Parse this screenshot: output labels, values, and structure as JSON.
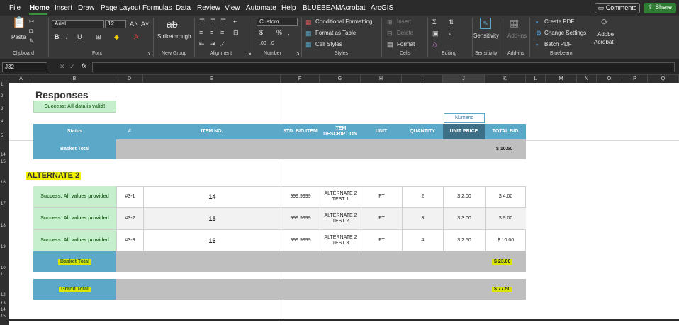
{
  "menu": {
    "items": [
      "File",
      "Home",
      "Insert",
      "Draw",
      "Page Layout",
      "Formulas",
      "Data",
      "Review",
      "View",
      "Automate",
      "Help",
      "BLUEBEAM",
      "Acrobat",
      "ArcGIS"
    ],
    "comments": "Comments",
    "share": "Share"
  },
  "ribbon": {
    "paste": "Paste",
    "font_name": "Arial",
    "font_size": "12",
    "strikethrough": "Strikethrough",
    "number_format": "Custom",
    "conditional_formatting": "Conditional Formatting",
    "format_as_table": "Format as Table",
    "cell_styles": "Cell Styles",
    "insert": "Insert",
    "delete": "Delete",
    "format": "Format",
    "sensitivity": "Sensitivity",
    "addins": "Add-ins",
    "create_pdf": "Create PDF",
    "change_settings": "Change Settings",
    "batch_pdf": "Batch PDF",
    "adobe": "Adobe",
    "acrobat": "Acrobat",
    "groups": [
      "Clipboard",
      "Font",
      "New Group",
      "Alignment",
      "Number",
      "Styles",
      "Cells",
      "Editing",
      "Sensitivity",
      "Add-ins",
      "Bluebeam"
    ]
  },
  "formula_bar": {
    "name_box": "J32",
    "fx": "fx",
    "formula": ""
  },
  "columns": [
    "A",
    "B",
    "D",
    "E",
    "F",
    "G",
    "H",
    "I",
    "J",
    "K",
    "L",
    "M",
    "N",
    "O",
    "P",
    "Q"
  ],
  "rows": [
    "1",
    "2",
    "3",
    "4",
    "5",
    "14",
    "15",
    "16",
    "17",
    "18",
    "19",
    "10",
    "11",
    "12",
    "13",
    "14",
    "15"
  ],
  "sheet": {
    "title": "Responses",
    "validation": "Success: All data is valid!",
    "numeric_label": "Numeric",
    "headers": [
      "Status",
      "#",
      "ITEM NO.",
      "STD. BID ITEM",
      "ITEM DESCRIPTION",
      "UNIT",
      "QUANTITY",
      "UNIT PRICE",
      "TOTAL BID"
    ],
    "basket_total_label": "Basket Total",
    "basket_total_value": "$ 10.50",
    "section_title": "ALTERNATE 2",
    "items": [
      {
        "status": "Success: All values provided",
        "num": "#3-1",
        "item_no": "14",
        "std": "999.9999",
        "desc": "ALTERNATE 2 TEST 1",
        "unit": "FT",
        "qty": "2",
        "price": "$ 2.00",
        "total": "$ 4.00"
      },
      {
        "status": "Success: All values provided",
        "num": "#3-2",
        "item_no": "15",
        "std": "999.9999",
        "desc": "ALTERNATE 2 TEST 2",
        "unit": "FT",
        "qty": "3",
        "price": "$ 3.00",
        "total": "$ 9.00"
      },
      {
        "status": "Success: All values provided",
        "num": "#3-3",
        "item_no": "16",
        "std": "999.9999",
        "desc": "ALTERNATE 2 TEST 3",
        "unit": "FT",
        "qty": "4",
        "price": "$ 2.50",
        "total": "$ 10.00"
      }
    ],
    "basket_total2_label": "Basket Total",
    "basket_total2_value": "$ 23.00",
    "grand_total_label": "Grand Total",
    "grand_total_value": "$ 77.50"
  },
  "colors": {
    "header_blue": "#5ba8c8",
    "success_green": "#c6efce",
    "gray": "#bfbfbf",
    "highlight": "#d8e600"
  }
}
